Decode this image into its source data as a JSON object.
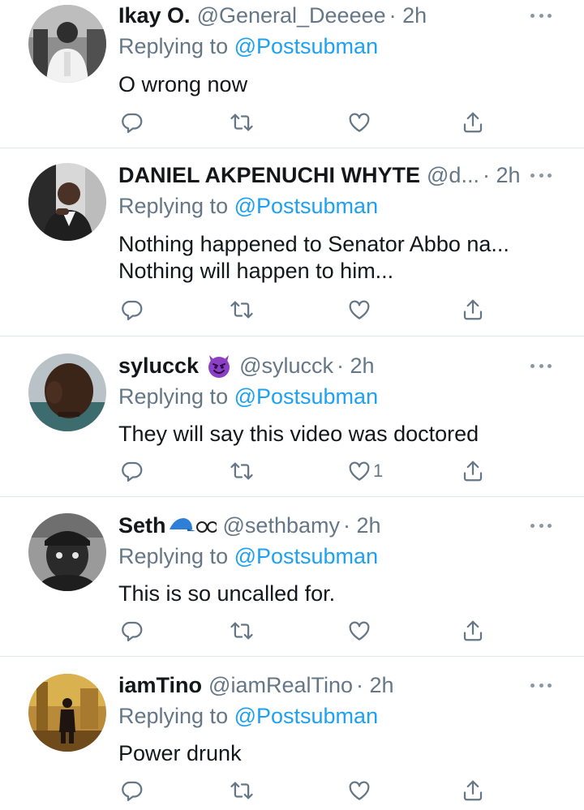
{
  "tweets": [
    {
      "name": "Ikay O.",
      "handle": "@General_Deeeee",
      "time": "· 2h",
      "replying_prefix": "Replying to ",
      "replying_to": "@Postsubman",
      "text_lines": [
        "O wrong now"
      ],
      "like_count": ""
    },
    {
      "name": "DANIEL AKPENUCHI WHYTE",
      "handle": "@d...",
      "time": "· 2h",
      "replying_prefix": "Replying to ",
      "replying_to": "@Postsubman",
      "text_lines": [
        "Nothing happened to Senator Abbo na...",
        "Nothing will happen to him..."
      ],
      "like_count": ""
    },
    {
      "name": "sylucck",
      "name_emoji": "smiling-devil-emoji",
      "handle": "@sylucck",
      "time": "· 2h",
      "replying_prefix": "Replying to ",
      "replying_to": "@Postsubman",
      "text_lines": [
        "They will say this video was doctored"
      ],
      "like_count": "1"
    },
    {
      "name": "Seth",
      "name_emoji": "blue-cap-and-sunglasses-emoji",
      "handle": "@sethbamy",
      "time": "· 2h",
      "replying_prefix": "Replying to ",
      "replying_to": "@Postsubman",
      "text_lines": [
        "This is so uncalled for."
      ],
      "like_count": ""
    },
    {
      "name": "iamTino",
      "handle": "@iamRealTino",
      "time": "· 2h",
      "replying_prefix": "Replying to ",
      "replying_to": "@Postsubman",
      "text_lines": [
        "Power drunk"
      ],
      "like_count": ""
    }
  ],
  "colors": {
    "text": "#14171a",
    "secondary": "#657786",
    "link": "#1da1f2",
    "divider": "#e1e8ed"
  },
  "icons": {
    "reply": "reply-icon",
    "retweet": "retweet-icon",
    "like": "like-icon",
    "share": "share-icon",
    "more": "more-dots-icon"
  }
}
